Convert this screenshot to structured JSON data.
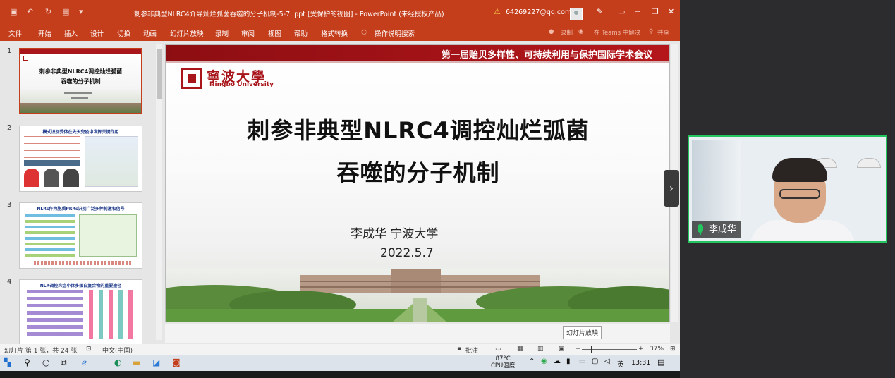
{
  "window": {
    "title": "刺参非典型NLRC4介导灿烂弧菌吞噬的分子机制-5-7. ppt [受保护的视图] - PowerPoint (未经授权产品)",
    "account": "64269227@qq.com",
    "warning_icon": "warning-icon"
  },
  "ribbon": {
    "tabs": [
      "文件",
      "开始",
      "插入",
      "设计",
      "切换",
      "动画",
      "幻灯片放映",
      "录制",
      "审阅",
      "视图",
      "帮助",
      "格式转换"
    ],
    "search_label": "操作说明搜索",
    "record_label": "录制",
    "teams_label": "在 Teams 中解决",
    "share_label": "共享"
  },
  "thumbnails": [
    {
      "num": "1",
      "title_line1": "刺参非典型NLRC4调控灿烂弧菌",
      "title_line2": "吞噬的分子机制",
      "selected": true
    },
    {
      "num": "2",
      "title_line1": "模式识别受体在先天免疫中发挥关键作用",
      "selected": false
    },
    {
      "num": "3",
      "title_line1": "NLRs作为胞质PRRs识别广泛多种刺激和信号",
      "selected": false
    },
    {
      "num": "4",
      "title_line1": "NLR调控炎症小体多蛋白复合物的重要途径",
      "selected": false
    }
  ],
  "slide": {
    "banner": "第一届贻贝多样性、可持续利用与保护国际学术会议",
    "logo_cn": "寧波大學",
    "logo_en": "Ningbo University",
    "title_line1": "刺参非典型NLRC4调控灿烂弧菌",
    "title_line2": "吞噬的分子机制",
    "author": "李成华  宁波大学",
    "date": "2022.5.7"
  },
  "tooltip": "幻灯片放映",
  "status": {
    "slide_count": "幻灯片 第 1 张，共 24 张",
    "language": "中文(中国)",
    "notes": "批注",
    "zoom": "37%"
  },
  "taskbar": {
    "temperature": "87°C",
    "temp_label": "CPU温度",
    "ime": "英",
    "time": "13:31"
  },
  "video": {
    "participant": "李成华"
  }
}
